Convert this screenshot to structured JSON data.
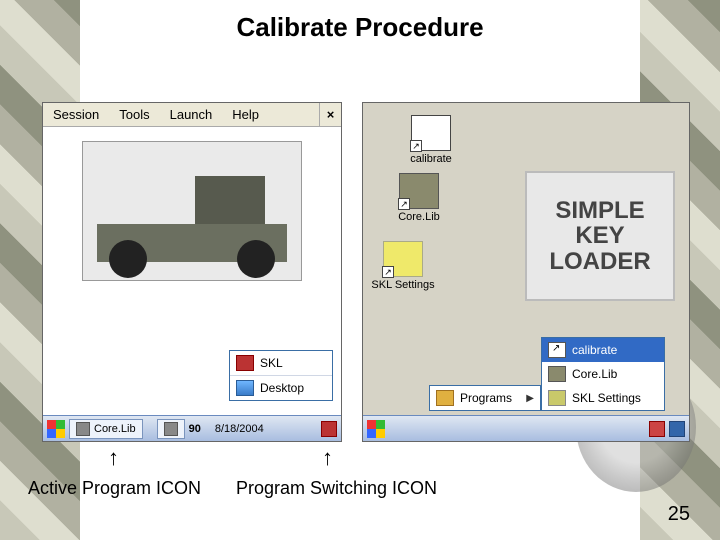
{
  "slide": {
    "title": "Calibrate Procedure",
    "number": "25"
  },
  "labels": {
    "active_program_icon": "Active Program ICON",
    "program_switching_icon": "Program Switching ICON"
  },
  "left": {
    "menu": {
      "session": "Session",
      "tools": "Tools",
      "launch": "Launch",
      "help": "Help",
      "close": "×"
    },
    "popup": {
      "skl": "SKL",
      "desktop": "Desktop"
    },
    "taskbar": {
      "corelib": "Core.Lib",
      "ninety": "90",
      "date": "8/18/2004"
    }
  },
  "right": {
    "desk": {
      "calibrate": "calibrate",
      "corelib": "Core.Lib",
      "sklsettings": "SKL Settings"
    },
    "sklbox": "SIMPLE KEY LOADER",
    "programs_label": "Programs",
    "flyout": {
      "calibrate": "calibrate",
      "corelib": "Core.Lib",
      "sklsettings": "SKL Settings"
    }
  }
}
